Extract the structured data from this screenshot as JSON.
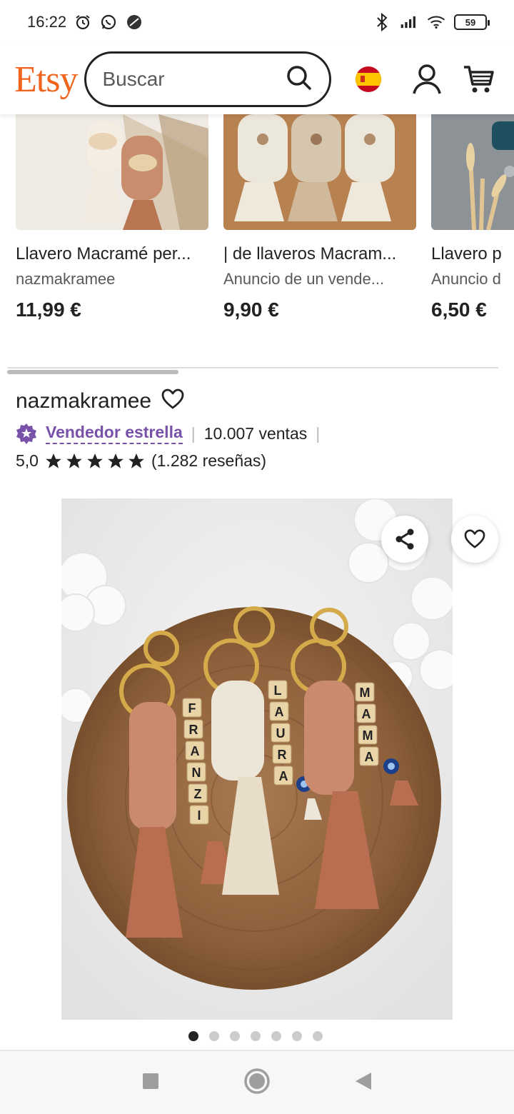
{
  "status_bar": {
    "time": "16:22",
    "battery": "59"
  },
  "header": {
    "logo": "Etsy",
    "search_placeholder": "Buscar"
  },
  "carousel": {
    "items": [
      {
        "title": "Llavero Macramé per...",
        "seller": "nazmakramee",
        "price": "11,99 €"
      },
      {
        "title": "| de llaveros Macram...",
        "seller": "Anuncio de un vende...",
        "price": "9,90 €"
      },
      {
        "title": "Llavero p",
        "seller": "Anuncio d",
        "price": "6,50 €"
      }
    ]
  },
  "shop": {
    "name": "nazmakramee",
    "star_seller_label": "Vendedor estrella",
    "sales": "10.007 ventas",
    "rating": "5,0",
    "reviews": "(1.282 reseñas)",
    "star_count": 5
  },
  "gallery": {
    "image_count": 7,
    "active_index": 0,
    "tags": [
      "FRANZI",
      "LAURA",
      "MAMA"
    ]
  },
  "colors": {
    "brand": "#f1641e",
    "star_seller": "#7851a9"
  }
}
